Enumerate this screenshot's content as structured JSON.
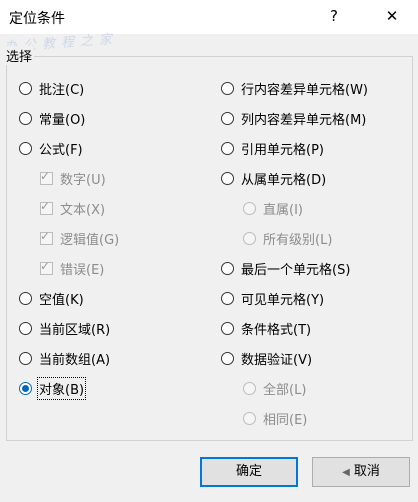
{
  "window": {
    "title": "定位条件",
    "help_label": "?",
    "close_label": "✕"
  },
  "watermark": "办公教程之家",
  "group_label": "选择",
  "left_options": [
    {
      "label": "批注(C)"
    },
    {
      "label": "常量(O)"
    },
    {
      "label": "公式(F)"
    },
    {
      "label": "数字(U)"
    },
    {
      "label": "文本(X)"
    },
    {
      "label": "逻辑值(G)"
    },
    {
      "label": "错误(E)"
    },
    {
      "label": "空值(K)"
    },
    {
      "label": "当前区域(R)"
    },
    {
      "label": "当前数组(A)"
    },
    {
      "label": "对象(B)",
      "checked": true
    }
  ],
  "right_options": [
    {
      "label": "行内容差异单元格(W)"
    },
    {
      "label": "列内容差异单元格(M)"
    },
    {
      "label": "引用单元格(P)"
    },
    {
      "label": "从属单元格(D)"
    },
    {
      "label": "直属(I)"
    },
    {
      "label": "所有级别(L)"
    },
    {
      "label": "最后一个单元格(S)"
    },
    {
      "label": "可见单元格(Y)"
    },
    {
      "label": "条件格式(T)"
    },
    {
      "label": "数据验证(V)"
    },
    {
      "label": "全部(L)"
    },
    {
      "label": "相同(E)"
    }
  ],
  "buttons": {
    "ok": "确定",
    "cancel": "取消"
  }
}
